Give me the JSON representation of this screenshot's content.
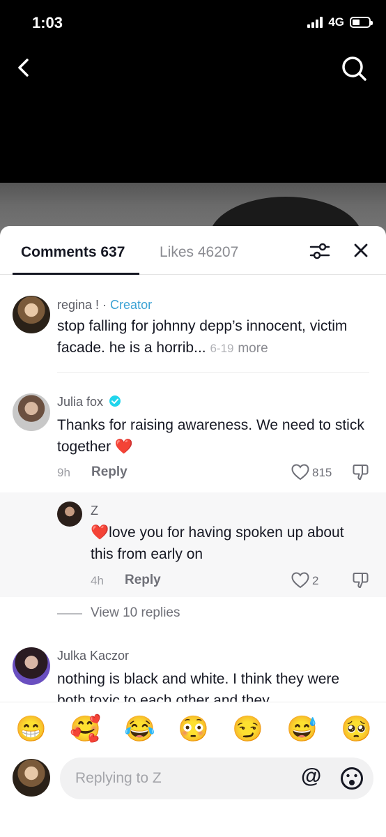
{
  "status": {
    "time": "1:03",
    "network": "4G"
  },
  "tabs": {
    "comments": "Comments 637",
    "likes": "Likes 46207"
  },
  "comments": [
    {
      "username": "regina ! · ",
      "badge": "Creator",
      "text": "stop falling for johnny depp’s innocent, victim facade. he is a horrib...",
      "date": "6-19",
      "more": "more"
    },
    {
      "username": "Julia fox",
      "verified": true,
      "text": "Thanks for raising awareness. We need to stick together",
      "emoji": "❤️",
      "time": "9h",
      "reply_label": "Reply",
      "likes": "815"
    },
    {
      "username": "Julka Kaczor",
      "text": "nothing is black and white. I think they were both toxic to each other and they"
    }
  ],
  "nested_reply": {
    "username": "Z",
    "emoji": "❤️",
    "text": "love you for having spoken up about this from early on",
    "time": "4h",
    "reply_label": "Reply",
    "likes": "2"
  },
  "view_replies": "View 10 replies",
  "emojis": [
    "😁",
    "🥰",
    "😂",
    "😳",
    "😏",
    "😅",
    "🥺"
  ],
  "input": {
    "placeholder": "Replying to Z",
    "at_symbol": "@"
  }
}
